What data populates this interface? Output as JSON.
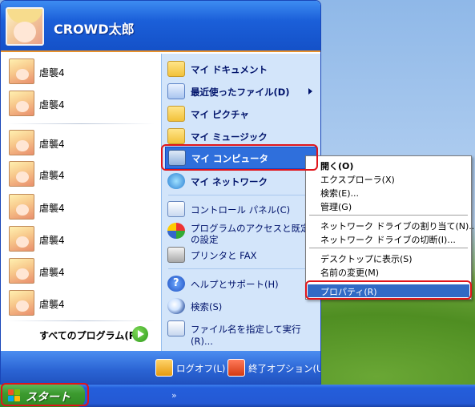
{
  "user": {
    "name": "CROWD太郎"
  },
  "recent_programs": [
    {
      "label": "虐襲4"
    },
    {
      "label": "虐襲4"
    },
    {
      "label": "虐襲4"
    },
    {
      "label": "虐襲4"
    },
    {
      "label": "虐襲4"
    },
    {
      "label": "虐襲4"
    },
    {
      "label": "虐襲4"
    },
    {
      "label": "虐襲4"
    }
  ],
  "all_programs": {
    "label": "すべてのプログラム(P)"
  },
  "places": [
    {
      "label": "マイ ドキュメント",
      "icon": "folder-documents-icon"
    },
    {
      "label": "最近使ったファイル(D)",
      "icon": "recent-documents-icon"
    },
    {
      "label": "マイ ピクチャ",
      "icon": "folder-pictures-icon"
    },
    {
      "label": "マイ ミュージック",
      "icon": "folder-music-icon"
    },
    {
      "label": "マイ コンピュータ",
      "icon": "my-computer-icon"
    },
    {
      "label": "マイ ネットワーク",
      "icon": "my-network-icon"
    }
  ],
  "system": [
    {
      "label": "コントロール パネル(C)",
      "icon": "control-panel-icon"
    },
    {
      "label": "プログラムのアクセスと既定の設定",
      "icon": "default-programs-icon"
    },
    {
      "label": "プリンタと FAX",
      "icon": "printer-icon"
    }
  ],
  "support": [
    {
      "label": "ヘルプとサポート(H)",
      "icon": "help-icon"
    },
    {
      "label": "検索(S)",
      "icon": "search-icon"
    },
    {
      "label": "ファイル名を指定して実行(R)...",
      "icon": "run-icon"
    }
  ],
  "footer": {
    "logoff": "ログオフ(L)",
    "shutdown": "終了オプション(U)"
  },
  "context_menu": {
    "items": [
      {
        "label": "開く(O)"
      },
      {
        "label": "エクスプローラ(X)"
      },
      {
        "label": "検索(E)..."
      },
      {
        "label": "管理(G)"
      },
      {
        "label": "ネットワーク ドライブの割り当て(N)..."
      },
      {
        "label": "ネットワーク ドライブの切断(I)..."
      },
      {
        "label": "デスクトップに表示(S)"
      },
      {
        "label": "名前の変更(M)"
      },
      {
        "label": "プロパティ(R)"
      }
    ]
  },
  "taskbar": {
    "start_label": "スタート",
    "chevron": "»"
  },
  "colors": {
    "highlight": "#e0141a",
    "selection": "#316ac5",
    "menu_blue": "#1b5fd9"
  }
}
